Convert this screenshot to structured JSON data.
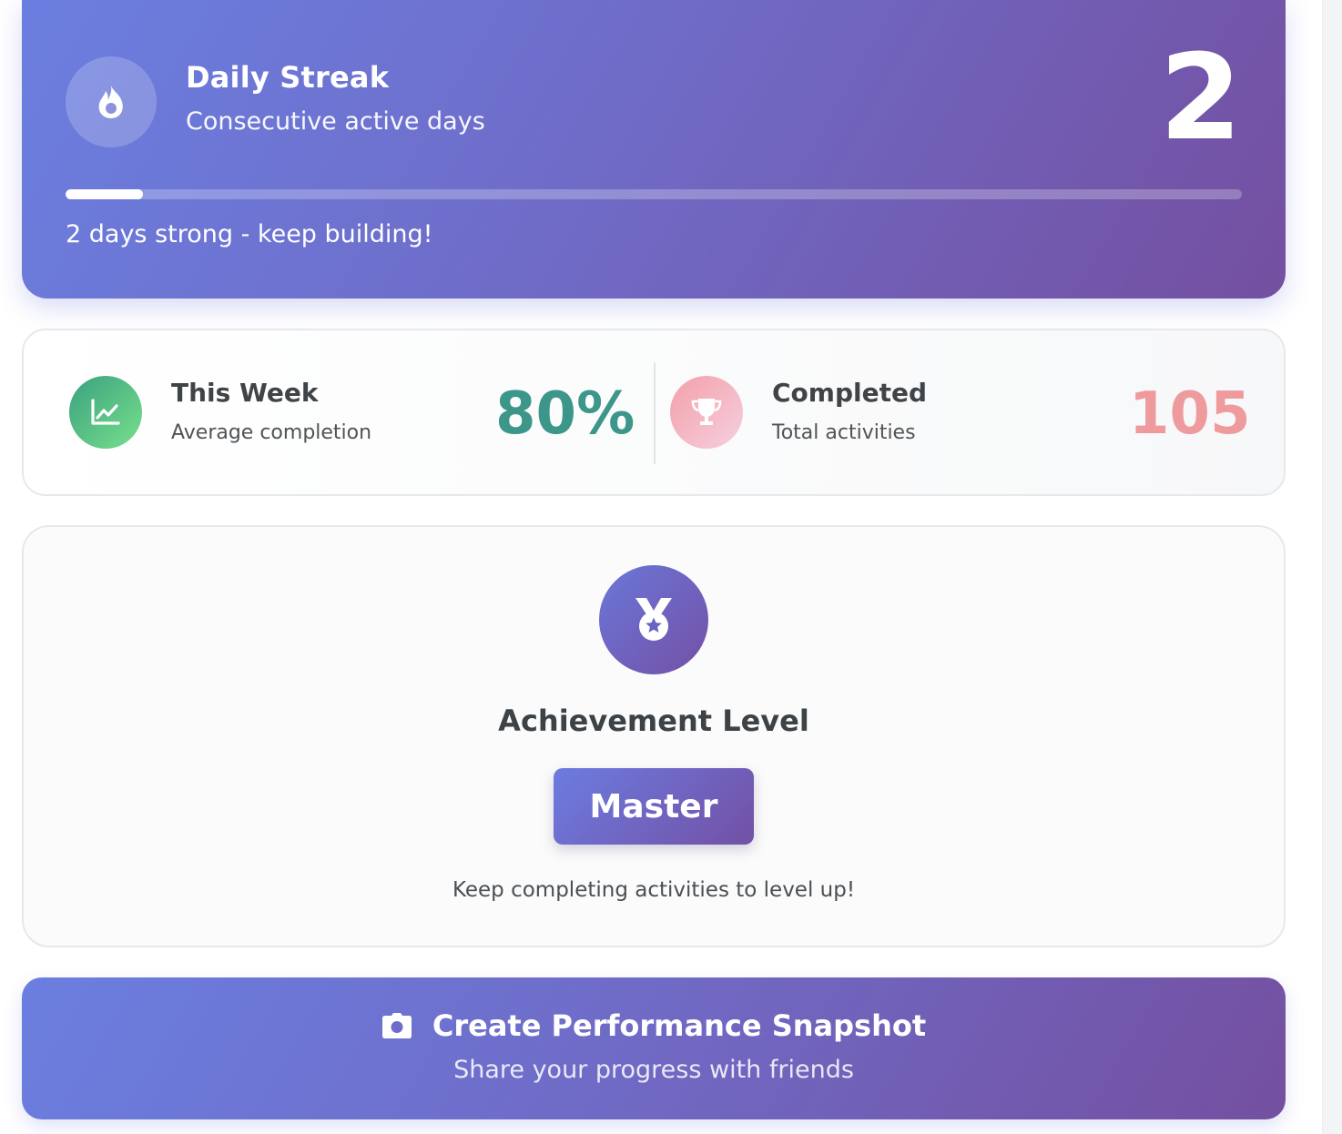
{
  "streak": {
    "title": "Daily Streak",
    "subtitle": "Consecutive active days",
    "count": "2",
    "progress_fraction": 0.066,
    "message": "2 days strong - keep building!",
    "icon": "fire-icon"
  },
  "stats": {
    "week": {
      "title": "This Week",
      "subtitle": "Average completion",
      "value": "80%",
      "icon": "chart-line-icon",
      "color": "#3d968a"
    },
    "completed": {
      "title": "Completed",
      "subtitle": "Total activities",
      "value": "105",
      "icon": "trophy-icon",
      "color": "#ef9a9d"
    }
  },
  "achievement": {
    "title": "Achievement Level",
    "level": "Master",
    "hint": "Keep completing activities to level up!",
    "icon": "medal-icon"
  },
  "snapshot": {
    "label": "Create Performance Snapshot",
    "subtitle": "Share your progress with friends",
    "icon": "camera-icon"
  },
  "colors": {
    "gradient_start": "#6b7fe0",
    "gradient_end": "#744fa0",
    "week_accent": "#3d968a",
    "completed_accent": "#ef9a9d"
  }
}
